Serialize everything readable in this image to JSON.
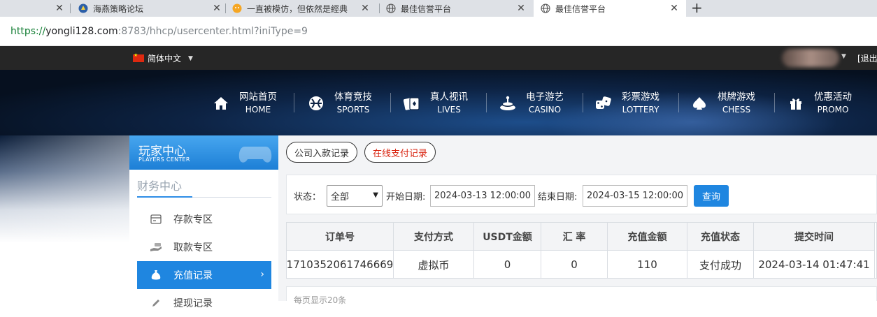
{
  "browser": {
    "tabs": [
      {
        "title": "",
        "active": false
      },
      {
        "title": "海燕策略论坛",
        "active": false
      },
      {
        "title": "一直被模仿，但依然是經典",
        "active": false
      },
      {
        "title": "最佳信誉平台",
        "active": false
      },
      {
        "title": "最佳信誉平台",
        "active": true
      }
    ],
    "close_glyph": "✕",
    "new_tab_glyph": "+",
    "url": {
      "scheme": "https://",
      "host": "yongli128.com",
      "rest": ":8783/hhcp/usercenter.html?iniType=9"
    }
  },
  "site": {
    "language": "简体中文",
    "logout": "[退出",
    "nav": [
      {
        "cn": "网站首页",
        "en": "HOME",
        "icon": "home-icon"
      },
      {
        "cn": "体育竞技",
        "en": "SPORTS",
        "icon": "ball-icon"
      },
      {
        "cn": "真人视讯",
        "en": "LIVES",
        "icon": "cards-icon"
      },
      {
        "cn": "电子游艺",
        "en": "CASINO",
        "icon": "slot-icon"
      },
      {
        "cn": "彩票游戏",
        "en": "LOTTERY",
        "icon": "dice-icon"
      },
      {
        "cn": "棋牌游戏",
        "en": "CHESS",
        "icon": "spade-icon"
      },
      {
        "cn": "优惠活动",
        "en": "PROMO",
        "icon": "gift-icon"
      }
    ]
  },
  "sidebar": {
    "header_cn": "玩家中心",
    "header_en": "PLAYERS CENTER",
    "section_title": "财务中心",
    "items": [
      {
        "label": "存款专区",
        "icon": "deposit-icon",
        "active": false
      },
      {
        "label": "取款专区",
        "icon": "withdraw-icon",
        "active": false
      },
      {
        "label": "充值记录",
        "icon": "moneybag-icon",
        "active": true
      },
      {
        "label": "提现记录",
        "icon": "pen-icon",
        "active": false
      }
    ],
    "active_arrow": "›"
  },
  "main": {
    "tabs": [
      {
        "label": "公司入款记录",
        "active": false
      },
      {
        "label": "在线支付记录",
        "active": true
      }
    ],
    "filter": {
      "status_label": "状态：",
      "status_value": "全部",
      "start_label": "开始日期:",
      "start_value": "2024-03-13 12:00:00",
      "end_label": "结束日期:",
      "end_value": "2024-03-15 12:00:00",
      "query_button": "查询"
    },
    "table": {
      "headers": [
        "订单号",
        "支付方式",
        "USDT金额",
        "汇 率",
        "充值金额",
        "充值状态",
        "提交时间"
      ],
      "rows": [
        [
          "1710352061746669",
          "虚拟币",
          "0",
          "0",
          "110",
          "支付成功",
          "2024-03-14 01:47:41"
        ]
      ]
    },
    "footer_text": "每页显示20条"
  },
  "colors": {
    "accent": "#1f86e0",
    "active_tab_text": "#d9230f",
    "topstrip": "#262626"
  }
}
